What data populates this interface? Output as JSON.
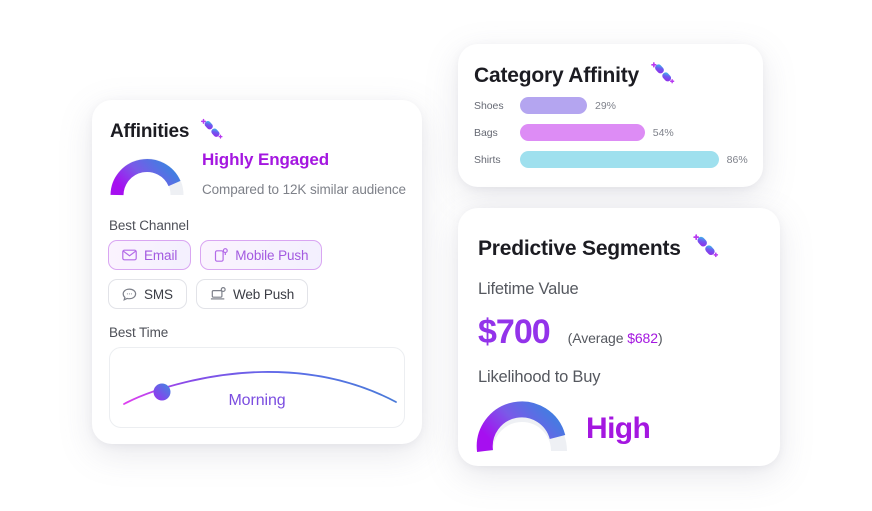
{
  "affinities": {
    "title": "Affinities",
    "logo_icon": "sparkle-ribbon-icon",
    "engagement_label": "Highly Engaged",
    "compared_text": "Compared to 12K similar audience",
    "gauge_percent": 78,
    "best_channel_label": "Best Channel",
    "channels": [
      {
        "label": "Email",
        "icon": "envelope-icon",
        "active": true
      },
      {
        "label": "Mobile Push",
        "icon": "mobile-push-icon",
        "active": true
      },
      {
        "label": "SMS",
        "icon": "chat-bubble-icon",
        "active": false
      },
      {
        "label": "Web Push",
        "icon": "web-push-icon",
        "active": false
      }
    ],
    "best_time_label": "Best Time",
    "best_time_value": "Morning"
  },
  "category_affinity": {
    "title": "Category Affinity",
    "logo_icon": "sparkle-ribbon-icon"
  },
  "predictive_segments": {
    "title": "Predictive Segments",
    "logo_icon": "sparkle-ribbon-icon",
    "lifetime_value_label": "Lifetime Value",
    "lifetime_value": "$700",
    "average_prefix": "(Average ",
    "average_value": "$682",
    "average_suffix": ")",
    "likelihood_label": "Likelihood to Buy",
    "likelihood_value": "High",
    "gauge_percent": 82
  },
  "colors": {
    "accent_purple": "#a417e0",
    "accent_violet": "#9333ea",
    "gauge_start": "#a810f0",
    "gauge_end": "#3b82e0",
    "gauge_track": "#eef0f4",
    "bar_shoes": "#b4a5f0",
    "bar_bags": "#dd8cf5",
    "bar_shirts": "#9fe0ee",
    "text_muted": "#7e8189"
  },
  "chart_data": {
    "type": "bar",
    "title": "Category Affinity",
    "orientation": "horizontal",
    "categories": [
      "Shoes",
      "Bags",
      "Shirts"
    ],
    "values": [
      29,
      54,
      86
    ],
    "value_labels": [
      "29%",
      "54%",
      "86%"
    ],
    "colors": [
      "#b4a5f0",
      "#dd8cf5",
      "#9fe0ee"
    ],
    "xlabel": "",
    "ylabel": "",
    "xlim": [
      0,
      100
    ],
    "grid": false,
    "legend": false
  }
}
